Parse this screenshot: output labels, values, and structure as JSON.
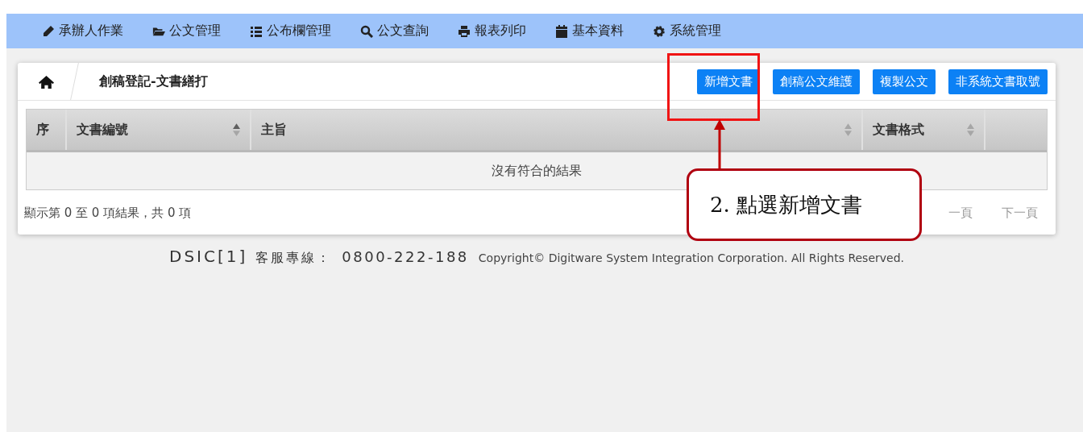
{
  "nav": [
    {
      "label": "承辦人作業"
    },
    {
      "label": "公文管理"
    },
    {
      "label": "公布欄管理"
    },
    {
      "label": "公文查詢"
    },
    {
      "label": "報表列印"
    },
    {
      "label": "基本資料"
    },
    {
      "label": "系統管理"
    }
  ],
  "panel": {
    "title": "創稿登記-文書繕打",
    "buttons": [
      "新增文書",
      "創稿公文維護",
      "複製公文",
      "非系統文書取號"
    ]
  },
  "table": {
    "columns": [
      {
        "label": "序",
        "sortable": false
      },
      {
        "label": "文書編號",
        "sortable": true,
        "sorted": true
      },
      {
        "label": "主旨",
        "sortable": true,
        "sorted": false
      },
      {
        "label": "文書格式",
        "sortable": true,
        "sorted": false
      }
    ],
    "empty_message": "沒有符合的結果"
  },
  "info": "顯示第 0 至 0 項結果，共 0 項",
  "pagination": [
    "一頁",
    "下一頁"
  ],
  "footer": {
    "brand": "DSIC[1]",
    "hotline_label": "客服專線：",
    "hotline": "0800-222-188",
    "copyright": "Copyright© Digitware System Integration Corporation. All Rights Reserved."
  },
  "callout": {
    "text": "2. 點選新增文書"
  }
}
